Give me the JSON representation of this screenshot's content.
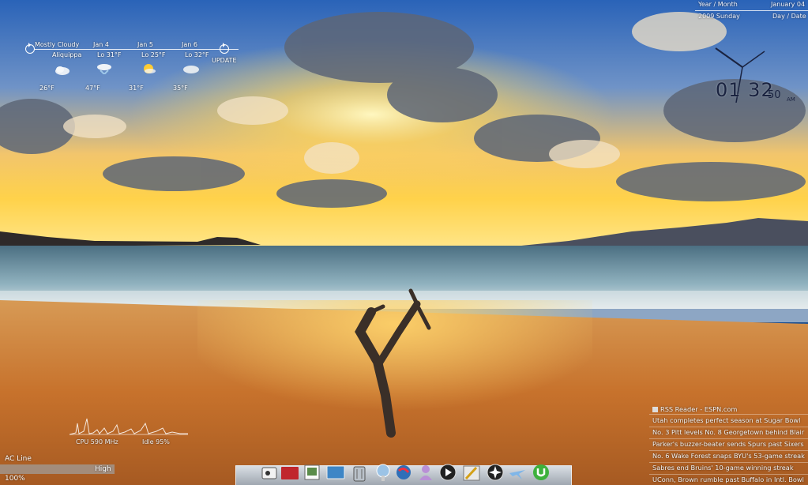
{
  "weather": {
    "condition": "Mostly Cloudy",
    "location": "Aliquippa",
    "update_label": "UPDATE",
    "current_temp": "26°F",
    "forecast": [
      {
        "day": "Jan 4",
        "low": "Lo 31°F",
        "high": "47°F",
        "icon": "rain-icon"
      },
      {
        "day": "Jan 5",
        "low": "Lo 25°F",
        "high": "31°F",
        "icon": "sun-cloud-icon"
      },
      {
        "day": "Jan 6",
        "low": "Lo 32°F",
        "high": "35°F",
        "icon": "cloud-icon"
      }
    ]
  },
  "clock": {
    "year_month_label": "Year / Month",
    "month_value": "January 04",
    "year_day_value": "2009 Sunday",
    "day_date_label": "Day / Date",
    "time": "01 32",
    "seconds": "50",
    "ampm": "AM"
  },
  "cpu": {
    "cpu_label": "CPU 590 MHz",
    "idle_label": "Idle 95%"
  },
  "power": {
    "source_label": "AC Line",
    "level_label": "High",
    "percent_label": "100%",
    "percent": 100
  },
  "rss": {
    "title": "RSS Reader - ESPN.com",
    "items": [
      "Utah completes perfect season at Sugar Bowl",
      "No. 3 Pitt levels No. 8 Georgetown behind Blair",
      "Parker's buzzer-beater sends Spurs past Sixers",
      "No. 6 Wake Forest snaps BYU's 53-game streak",
      "Sabres end Bruins' 10-game winning streak",
      "UConn, Brown rumble past Buffalo in Intl. Bowl"
    ]
  },
  "dock": {
    "icons": [
      "finder-icon",
      "red-folder-icon",
      "photo-icon",
      "monitor-icon",
      "trash-icon",
      "lamp-icon",
      "globe-icon",
      "people-icon",
      "media-player-icon",
      "pencil-icon",
      "star-icon",
      "plane-icon",
      "utorrent-icon"
    ]
  }
}
